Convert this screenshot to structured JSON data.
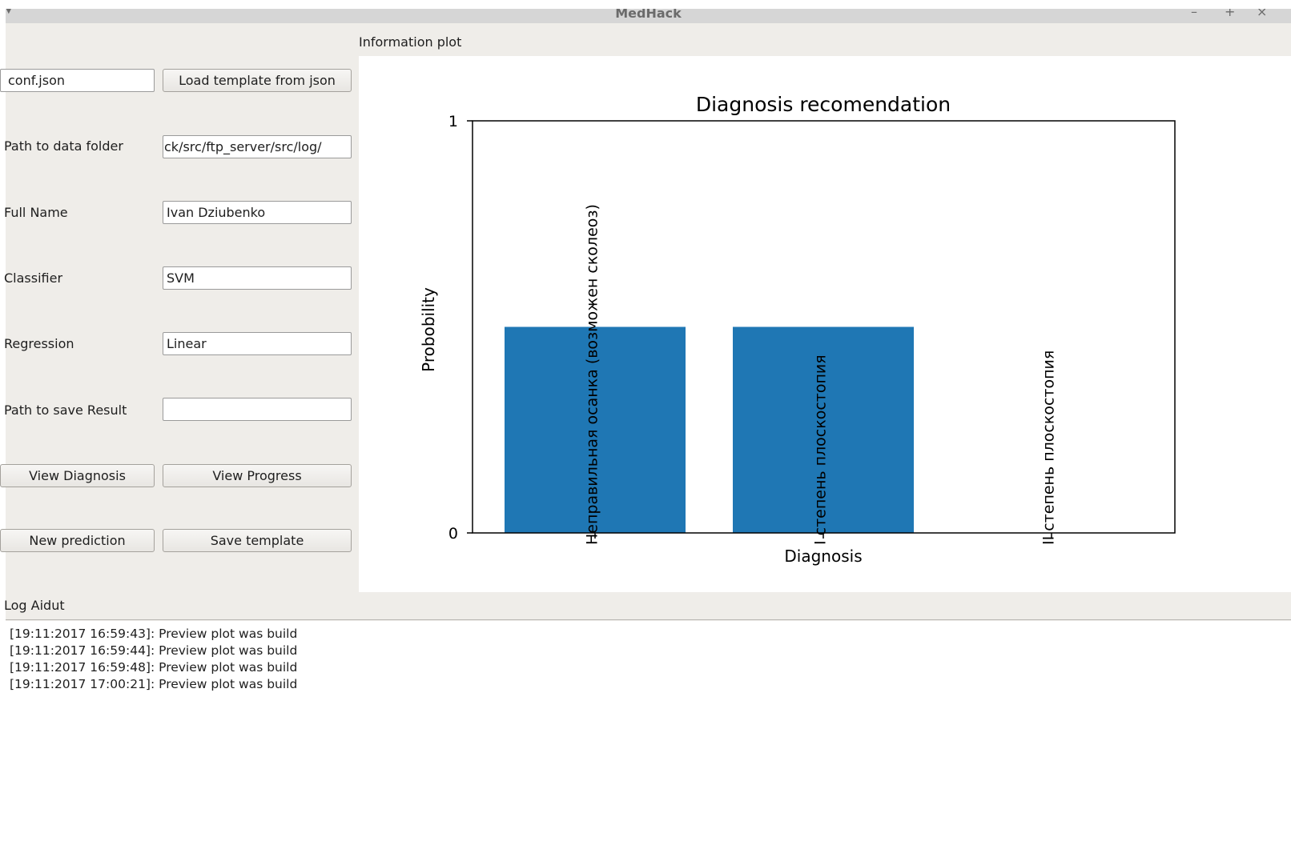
{
  "window": {
    "title": "MedHack",
    "minimize_glyph": "–",
    "maximize_glyph": "+",
    "close_glyph": "×"
  },
  "form": {
    "config_file": "conf.json",
    "load_template_button": "Load template from json",
    "data_folder_label": "Path to data folder",
    "data_folder_value": "ck/src/ftp_server/src/log/",
    "full_name_label": "Full Name",
    "full_name_value": "Ivan Dziubenko",
    "classifier_label": "Classifier",
    "classifier_value": "SVM",
    "regression_label": "Regression",
    "regression_value": "Linear",
    "save_result_label": "Path to save Result",
    "save_result_value": "",
    "view_diagnosis_button": "View Diagnosis",
    "view_progress_button": "View Progress",
    "new_prediction_button": "New prediction",
    "save_template_button": "Save template"
  },
  "plot_panel": {
    "label": "Information plot"
  },
  "chart_data": {
    "type": "bar",
    "title": "Diagnosis recomendation",
    "xlabel": "Diagnosis",
    "ylabel": "Probobility",
    "ylim": [
      0,
      1
    ],
    "yticks": [
      "0",
      "1"
    ],
    "categories": [
      "Неправильная осанка (возможен сколеоз)",
      "I степень плоскостопия",
      "II степень плоскостопия"
    ],
    "values": [
      0.5,
      0.5,
      0
    ],
    "bar_color": "#1f77b4"
  },
  "log": {
    "label": "Log Aidut",
    "lines": [
      "[19:11:2017 16:59:43]: Preview plot was build",
      "[19:11:2017 16:59:44]: Preview plot was build",
      "[19:11:2017 16:59:48]: Preview plot was build",
      "[19:11:2017 17:00:21]: Preview plot was build"
    ]
  }
}
